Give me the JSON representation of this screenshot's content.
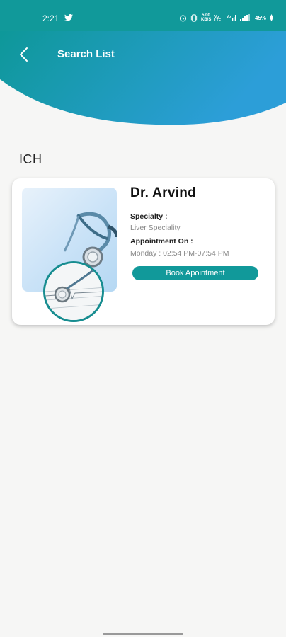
{
  "status_bar": {
    "time": "2:21",
    "speed": "5.00\nKB/S",
    "battery": "45%"
  },
  "header": {
    "title": "Search List",
    "color_start": "#0b9793",
    "color_end": "#2c9ed8"
  },
  "section": {
    "title": "ICH"
  },
  "doctor": {
    "name": "Dr. Arvind",
    "specialty_label": "Specialty :",
    "specialty_value": "Liver Speciality",
    "appointment_label": "Appointment On :",
    "appointment_value": "Monday : 02:54 PM-07:54 PM",
    "book_button_label": "Book Apointment"
  }
}
